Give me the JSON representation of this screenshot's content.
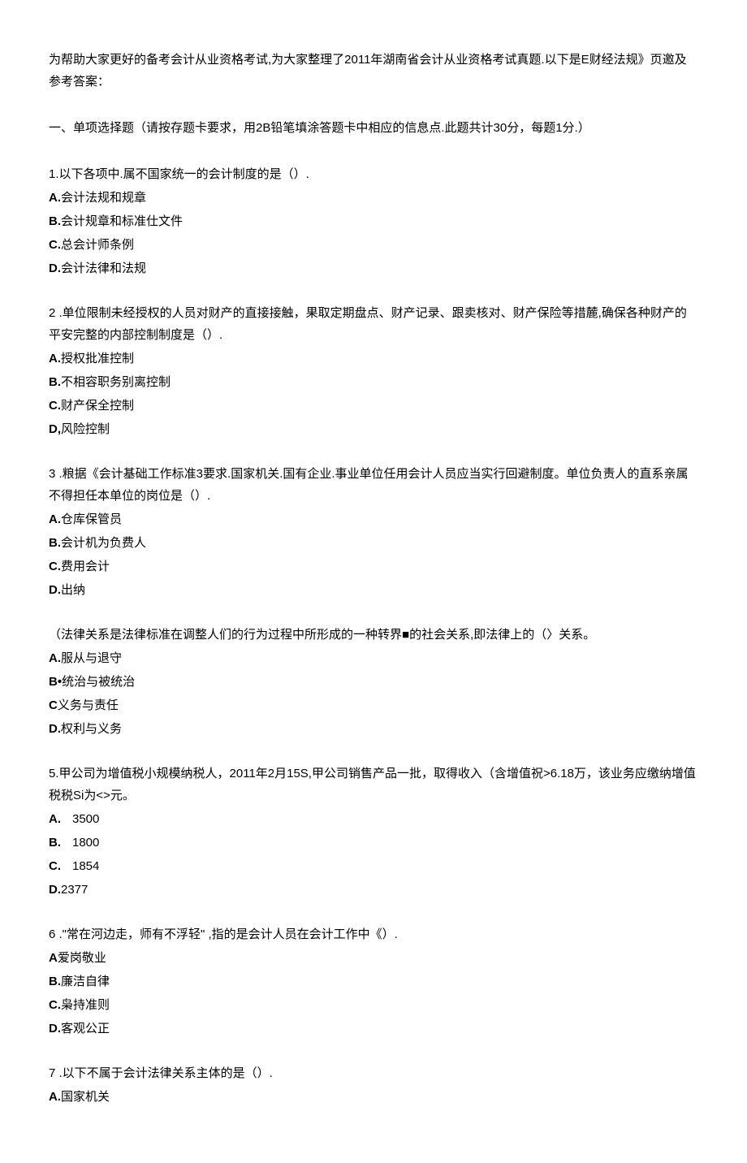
{
  "intro": "为帮助大家更好的备考会计从业资格考试,为大家整理了2011年湖南省会计从业资格考试真题.以下是E财经法规》页邀及参考答案：",
  "section_title": "一、单项选择题（请按存题卡要求，用2B铅笔填涂答题卡中相应的信息点.此题共计30分，每题1分.）",
  "questions": [
    {
      "stem": "1.以下各项中.属不国家统一的会计制度的是（）.",
      "options": [
        {
          "label": "A.",
          "text": "会计法规和规章"
        },
        {
          "label": "B.",
          "text": "会计规章和标准仕文件"
        },
        {
          "label": "C.",
          "text": "总会计师条例"
        },
        {
          "label": "D.",
          "text": "会计法律和法规"
        }
      ]
    },
    {
      "stem": "2    .单位限制未经授权的人员对财产的直接接触，果取定期盘点、财产记录、跟卖核对、财产保险等措麓,确保各种财产的平安完整的内部控制制度是（）.",
      "options": [
        {
          "label": "A.",
          "text": "授权批准控制"
        },
        {
          "label": "B.",
          "text": "不相容职务别离控制"
        },
        {
          "label": "C.",
          "text": "财产保全控制"
        },
        {
          "label": "D,",
          "text": "风险控制"
        }
      ]
    },
    {
      "stem": "3    .粮据《会计基础工作标准3要求.国家机关.国有企业.事业单位任用会计人员应当实行回避制度。单位负责人的直系亲属不得担任本单位的岗位是（）.",
      "options": [
        {
          "label": "A.",
          "text": "仓库保管员"
        },
        {
          "label": "B.",
          "text": "会计机为负费人"
        },
        {
          "label": "C.",
          "text": "费用会计"
        },
        {
          "label": "D.",
          "text": "出纳"
        }
      ]
    },
    {
      "stem": "（法律关系是法律标准在调整人们的行为过程中所形成的一种转界■的社会关系,即法律上的（〉关系。",
      "options": [
        {
          "label": "A.",
          "text": "服从与退守"
        },
        {
          "label": "B•",
          "text": "统治与被统治"
        },
        {
          "label": "C",
          "text": "义务与责任"
        },
        {
          "label": "D.",
          "text": "权利与义务"
        }
      ]
    },
    {
      "stem": "5.甲公司为增值税小规模纳税人，2011年2月15S,甲公司销售产品一批，取得收入（含增值祝>6.18万，该业务应缴纳增值税税Si为<>元。",
      "options": [
        {
          "label": "A.",
          "text": "3500",
          "spaced": true
        },
        {
          "label": "B.",
          "text": "1800",
          "spaced": true
        },
        {
          "label": "C.",
          "text": "1854",
          "spaced": true
        },
        {
          "label": "D.",
          "text": "2377"
        }
      ]
    },
    {
      "stem": "6    .\"常在河边走，师有不浮轻\" ,指的是会计人员在会计工作中《）.",
      "options": [
        {
          "label": "A",
          "text": "爱岗敬业"
        },
        {
          "label": "B.",
          "text": "廉洁自律"
        },
        {
          "label": "C.",
          "text": "枭持准则"
        },
        {
          "label": "D.",
          "text": "客观公正"
        }
      ]
    },
    {
      "stem": "7    .以下不属于会计法律关系主体的是（）.",
      "options": [
        {
          "label": "A.",
          "text": "国家机关"
        }
      ]
    }
  ]
}
